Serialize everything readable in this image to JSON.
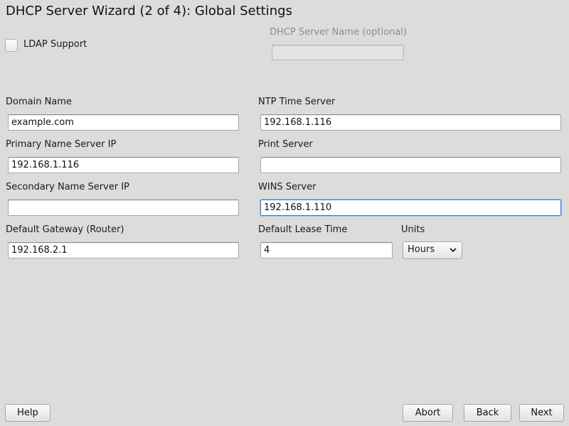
{
  "window": {
    "title": "DHCP Server Wizard (2 of 4): Global Settings"
  },
  "ldap": {
    "label": "LDAP Support",
    "checked": false
  },
  "server_name": {
    "label": "DHCP Server Name (optional)",
    "value": "",
    "enabled": false
  },
  "fields": {
    "domain_name": {
      "label": "Domain Name",
      "value": "example.com"
    },
    "ntp_server": {
      "label": "NTP Time Server",
      "value": "192.168.1.116"
    },
    "primary_ns": {
      "label": "Primary Name Server IP",
      "value": "192.168.1.116"
    },
    "print_server": {
      "label": "Print Server",
      "value": ""
    },
    "secondary_ns": {
      "label": "Secondary Name Server IP",
      "value": ""
    },
    "wins_server": {
      "label": "WINS Server",
      "value": "192.168.1.110"
    },
    "gateway": {
      "label": "Default Gateway (Router)",
      "value": "192.168.2.1"
    },
    "lease_time": {
      "label": "Default Lease Time",
      "value": "4"
    }
  },
  "units": {
    "label": "Units",
    "selected": "Hours"
  },
  "buttons": {
    "help": "Help",
    "abort": "Abort",
    "back": "Back",
    "next": "Next"
  },
  "colors": {
    "background": "#dedcda",
    "focus": "#3e7bd1"
  }
}
